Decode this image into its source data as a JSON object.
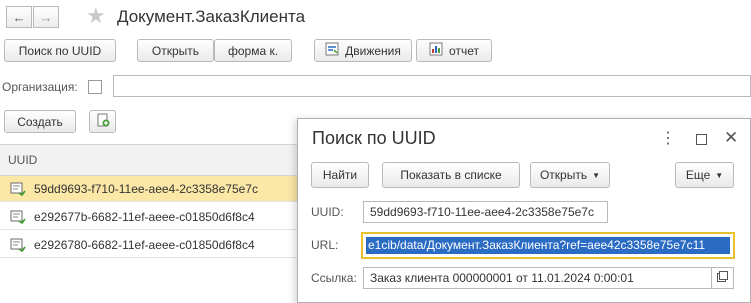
{
  "header": {
    "title": "Документ.ЗаказКлиента"
  },
  "toolbar": {
    "search_uuid": "Поиск по UUID",
    "open": "Открыть",
    "form": "форма к.",
    "movements": "Движения",
    "report": "отчет"
  },
  "filter": {
    "org_label": "Организация:",
    "org_value": ""
  },
  "actions": {
    "create": "Создать"
  },
  "list": {
    "column": "UUID",
    "rows": [
      "59dd9693-f710-11ee-aee4-2c3358e75e7c",
      "e292677b-6682-11ef-aeee-c01850d6f8c4",
      "e2926780-6682-11ef-aeee-c01850d6f8c4"
    ]
  },
  "dialog": {
    "title": "Поиск по UUID",
    "find": "Найти",
    "show_in_list": "Показать в списке",
    "open": "Открыть",
    "more": "Еще",
    "uuid_label": "UUID:",
    "uuid_value": "59dd9693-f710-11ee-aee4-2c3358e75e7c",
    "url_label": "URL:",
    "url_value": "e1cib/data/Документ.ЗаказКлиента?ref=aee42c3358e75e7c11",
    "link_label": "Ссылка:",
    "link_value": "Заказ клиента 000000001 от 11.01.2024 0:00:01"
  },
  "colors": {
    "selected_row": "#fbe7a6",
    "url_focus_border": "#e8c12e",
    "url_selection": "#2a6cc4"
  }
}
